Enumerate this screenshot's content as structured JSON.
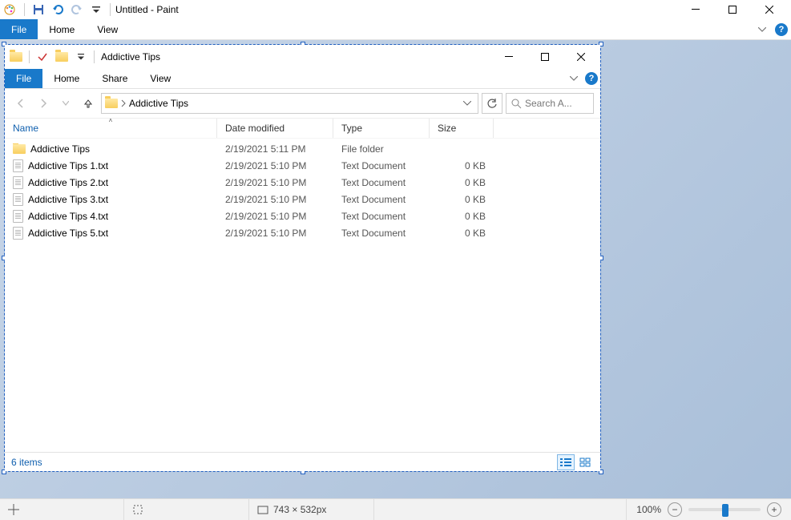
{
  "paint": {
    "title": "Untitled - Paint",
    "tabs": {
      "file": "File",
      "home": "Home",
      "view": "View"
    },
    "status": {
      "canvas_size": "743 × 532px",
      "zoom": "100%"
    }
  },
  "explorer": {
    "title": "Addictive Tips",
    "tabs": {
      "file": "File",
      "home": "Home",
      "share": "Share",
      "view": "View"
    },
    "breadcrumb": "Addictive Tips",
    "search_placeholder": "Search A...",
    "columns": {
      "name": "Name",
      "date": "Date modified",
      "type": "Type",
      "size": "Size"
    },
    "items": [
      {
        "icon": "folder",
        "name": "Addictive Tips",
        "date": "2/19/2021 5:11 PM",
        "type": "File folder",
        "size": ""
      },
      {
        "icon": "txt",
        "name": "Addictive Tips 1.txt",
        "date": "2/19/2021 5:10 PM",
        "type": "Text Document",
        "size": "0 KB"
      },
      {
        "icon": "txt",
        "name": "Addictive Tips 2.txt",
        "date": "2/19/2021 5:10 PM",
        "type": "Text Document",
        "size": "0 KB"
      },
      {
        "icon": "txt",
        "name": "Addictive Tips 3.txt",
        "date": "2/19/2021 5:10 PM",
        "type": "Text Document",
        "size": "0 KB"
      },
      {
        "icon": "txt",
        "name": "Addictive Tips 4.txt",
        "date": "2/19/2021 5:10 PM",
        "type": "Text Document",
        "size": "0 KB"
      },
      {
        "icon": "txt",
        "name": "Addictive Tips 5.txt",
        "date": "2/19/2021 5:10 PM",
        "type": "Text Document",
        "size": "0 KB"
      }
    ],
    "status": "6 items"
  }
}
